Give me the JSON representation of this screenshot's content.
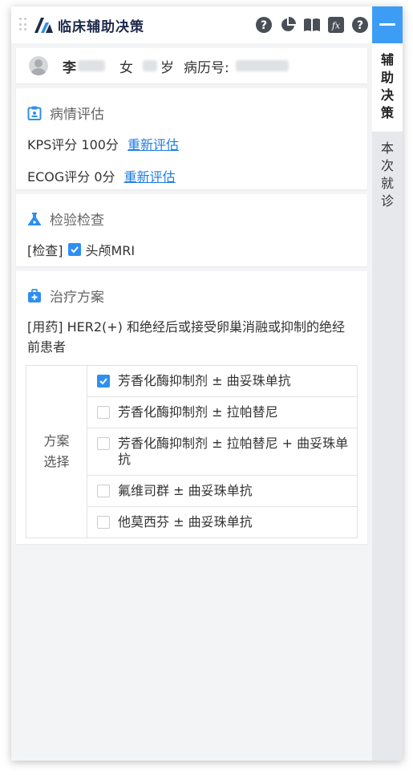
{
  "app": {
    "title": "临床辅助决策"
  },
  "toolbar": {
    "icons": [
      "help-icon",
      "pie-chart-icon",
      "book-icon",
      "formula-icon",
      "question-icon"
    ]
  },
  "side_tabs": [
    {
      "label": "辅\n助\n决\n策",
      "active": true
    },
    {
      "label": "本\n次\n就\n诊",
      "active": false
    }
  ],
  "patient": {
    "surname": "李",
    "gender": "女",
    "age_suffix": "岁",
    "record_label": "病历号:"
  },
  "assessment": {
    "title": "病情评估",
    "kps_text": "KPS评分 100分",
    "kps_link": "重新评估",
    "ecog_text": "ECOG评分 0分",
    "ecog_link": "重新评估"
  },
  "exam": {
    "title": "检验检查",
    "tag": "[检查]",
    "item": "头颅MRI",
    "checked": true
  },
  "treatment": {
    "title": "治疗方案",
    "drug_line": "[用药] HER2(+) 和绝经后或接受卵巢消融或抑制的绝经前患者",
    "choice_label": "方案\n选择",
    "options": [
      {
        "label": "芳香化酶抑制剂 ± 曲妥珠单抗",
        "checked": true
      },
      {
        "label": "芳香化酶抑制剂 ± 拉帕替尼",
        "checked": false
      },
      {
        "label": "芳香化酶抑制剂 ± 拉帕替尼 + 曲妥珠单抗",
        "checked": false
      },
      {
        "label": "氟维司群 ± 曲妥珠单抗",
        "checked": false
      },
      {
        "label": "他莫西芬 ± 曲妥珠单抗",
        "checked": false
      }
    ]
  },
  "colors": {
    "accent": "#3d9df5",
    "link": "#1e7be0",
    "checkbox": "#2e8ff0"
  }
}
